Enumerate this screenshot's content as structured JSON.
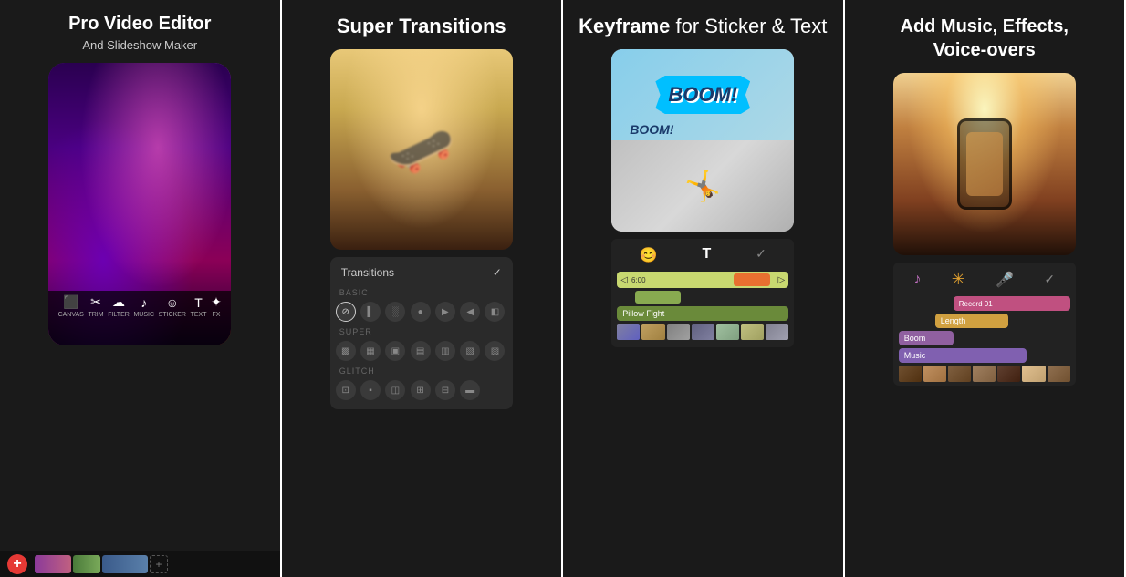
{
  "panels": [
    {
      "id": "panel-1",
      "title": "Pro Video Editor",
      "subtitle": "And Slideshow Maker",
      "toolbar_items": [
        {
          "icon": "⬛",
          "label": "CANVAS"
        },
        {
          "icon": "✂",
          "label": "TRIM"
        },
        {
          "icon": "☁",
          "label": "FILTER"
        },
        {
          "icon": "♪",
          "label": "MUSIC"
        },
        {
          "icon": "☺",
          "label": "STICKER"
        },
        {
          "icon": "T",
          "label": "TEXT"
        },
        {
          "icon": "✦",
          "label": "FX"
        }
      ]
    },
    {
      "id": "panel-2",
      "title": "Super Transitions",
      "subtitle": "",
      "transitions_header": "Transitions",
      "sections": [
        "BASIC",
        "SUPER",
        "GLITCH"
      ]
    },
    {
      "id": "panel-3",
      "title_normal": "for Sticker & Text",
      "title_bold": "Keyframe",
      "boom_text": "BOOM!",
      "boom_text2": "BOOM!",
      "label_track": "Pillow Fight"
    },
    {
      "id": "panel-4",
      "title_line1": "Add Music, Effects,",
      "title_line2": "Voice-overs",
      "tracks": [
        "Record 01",
        "Length",
        "Boom",
        "Music"
      ]
    }
  ]
}
